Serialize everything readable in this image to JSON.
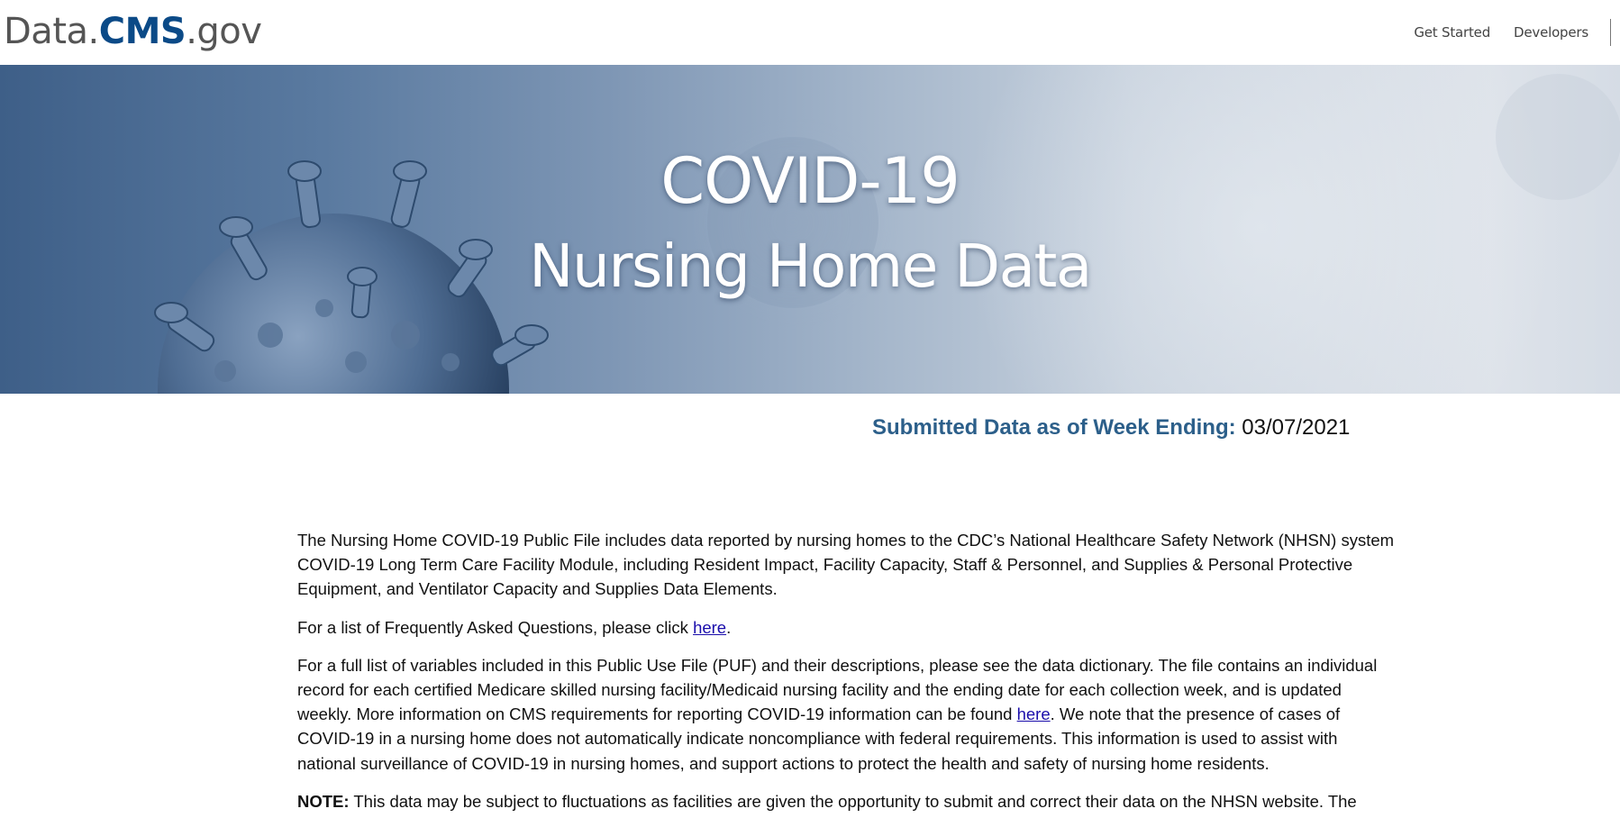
{
  "header": {
    "logo": {
      "part1": "Data.",
      "part2": "CMS",
      "part3": ".gov"
    },
    "nav": [
      {
        "label": "Get Started"
      },
      {
        "label": "Developers"
      }
    ]
  },
  "hero": {
    "title_line1": "COVID-19",
    "title_line2": "Nursing Home Data"
  },
  "week": {
    "label": "Submitted Data as of Week Ending:",
    "value": "03/07/2021"
  },
  "content": {
    "p1": "The Nursing Home COVID-19 Public File includes data reported by nursing homes to the CDC’s National Healthcare Safety Network (NHSN) system COVID-19 Long Term Care Facility Module, including Resident Impact, Facility Capacity, Staff & Personnel, and Supplies & Personal Protective Equipment, and Ventilator Capacity and Supplies Data Elements.",
    "p2_before": "For a list of Frequently Asked Questions, please click ",
    "p2_link": "here",
    "p2_after": ".",
    "p3_before": "For a full list of variables included in this Public Use File (PUF) and their descriptions, please see the data dictionary. The file contains an individual record for each certified Medicare skilled nursing facility/Medicaid nursing facility and the ending date for each collection week, and is updated weekly. More information on CMS requirements for reporting COVID-19 information can be found ",
    "p3_link": "here",
    "p3_after": ". We note that the presence of cases of COVID-19 in a nursing home does not automatically indicate noncompliance with federal requirements. This information is used to assist with national surveillance of COVID-19 in nursing homes, and support actions to protect the health and safety of nursing home residents.",
    "p4_bold": "NOTE:",
    "p4_text": " This data may be subject to fluctuations as facilities are given the opportunity to submit and correct their data on the NHSN website. The"
  },
  "colors": {
    "brand_blue": "#0b4a87",
    "week_label": "#2c5f8a",
    "link": "#1a0dab"
  }
}
